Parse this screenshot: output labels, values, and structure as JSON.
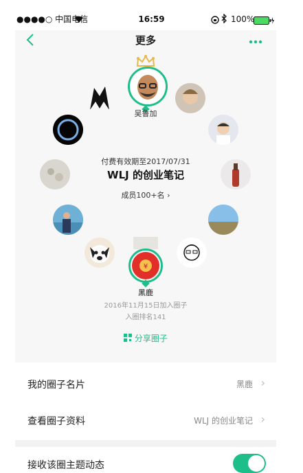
{
  "status_bar": {
    "carrier": "●●●●○ 中国电信",
    "time": "16:59",
    "battery": "100%"
  },
  "nav": {
    "title": "更多"
  },
  "circle": {
    "owner_name": "吴鲁加",
    "validity": "付费有效期至2017/07/31",
    "title": "WLJ 的创业笔记",
    "members": "成员100+名",
    "me_name": "黑鹿",
    "joined": "2016年11月15日加入圈子",
    "rank": "入圈排名141",
    "share_label": "分享圈子"
  },
  "settings": [
    {
      "label": "我的圈子名片",
      "value": "黑鹿"
    },
    {
      "label": "查看圈子资料",
      "value": "WLJ 的创业笔记"
    }
  ],
  "toggle_row": {
    "label": "接收该圈主题动态",
    "on": true
  },
  "colors": {
    "accent": "#1dbe8a",
    "red_badge": "#e12f2a",
    "crown": "#e8b84a"
  }
}
